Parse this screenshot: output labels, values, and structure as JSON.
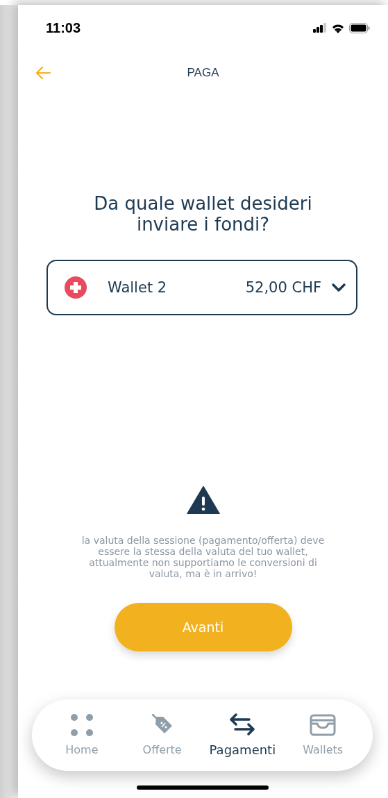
{
  "status_bar": {
    "time": "11:03"
  },
  "header": {
    "title": "PAGA"
  },
  "question": "Da quale wallet desideri inviare i fondi?",
  "wallet_select": {
    "name": "Wallet 2",
    "balance": "52,00 CHF"
  },
  "notice": "la valuta della sessione (pagamento/offerta) deve essere la stessa della valuta del tuo wallet, attualmente non supportiamo le conversioni di valuta, ma è in arrivo!",
  "primary_button": "Avanti",
  "tabs": [
    {
      "kind": "home",
      "label": "Home",
      "selected": false
    },
    {
      "kind": "offers",
      "label": "Offerte",
      "selected": false
    },
    {
      "kind": "payments",
      "label": "Pagamenti",
      "selected": true
    },
    {
      "kind": "wallets",
      "label": "Wallets",
      "selected": false
    }
  ]
}
